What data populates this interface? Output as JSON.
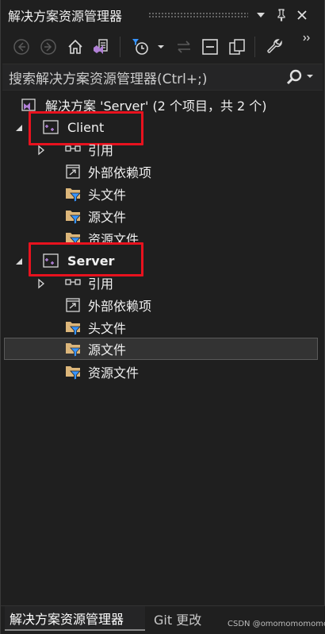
{
  "window": {
    "title": "解决方案资源管理器",
    "dropdown_glyph": "▾",
    "pin_glyph": "📌",
    "close_glyph": "✕"
  },
  "search": {
    "placeholder": "搜索解决方案资源管理器(Ctrl+;)"
  },
  "tree": {
    "solution": "解决方案 'Server' (2 个项目，共 2 个)",
    "projects": [
      {
        "name": "Client",
        "children": [
          "引用",
          "外部依赖项",
          "头文件",
          "源文件",
          "资源文件"
        ]
      },
      {
        "name": "Server",
        "children": [
          "引用",
          "外部依赖项",
          "头文件",
          "源文件",
          "资源文件"
        ]
      }
    ]
  },
  "footer": {
    "tab_active": "解决方案资源管理器",
    "tab_git": "Git 更改",
    "watermark": "CSDN @omomomomomom"
  },
  "colors": {
    "background": "#1f1f1f",
    "highlight_box": "#e8121e",
    "vs_purple": "#b180d7",
    "folder_yellow": "#dcb67a",
    "filter_blue": "#3794ff"
  }
}
